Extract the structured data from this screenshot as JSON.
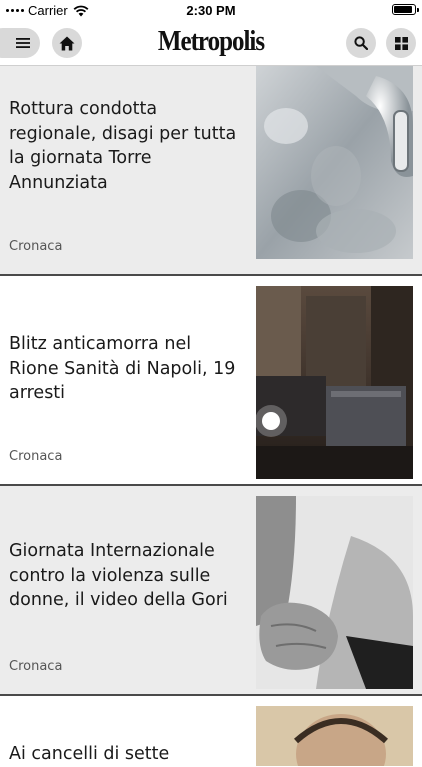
{
  "status_bar": {
    "carrier": "Carrier",
    "time": "2:30 PM",
    "battery_level": 0.9
  },
  "navbar": {
    "logo": "Metropolis",
    "icons": [
      "menu-icon",
      "home-icon",
      "search-icon",
      "grid-icon"
    ]
  },
  "articles": [
    {
      "title": "Rottura condotta regionale, disagi per tutta la giornata Torre Annunziata",
      "category": "Cronaca"
    },
    {
      "title": "Blitz anticamorra nel Rione Sanità di Napoli, 19 arresti",
      "category": "Cronaca"
    },
    {
      "title": "Giornata Internazionale contro la violenza sulle donne, il video della Gori",
      "category": "Cronaca"
    },
    {
      "title": "Ai cancelli di sette",
      "category": ""
    }
  ],
  "colors": {
    "card_grey": "#ececec",
    "button_grey": "#d9d9d9",
    "divider": "#4a4a4a"
  }
}
